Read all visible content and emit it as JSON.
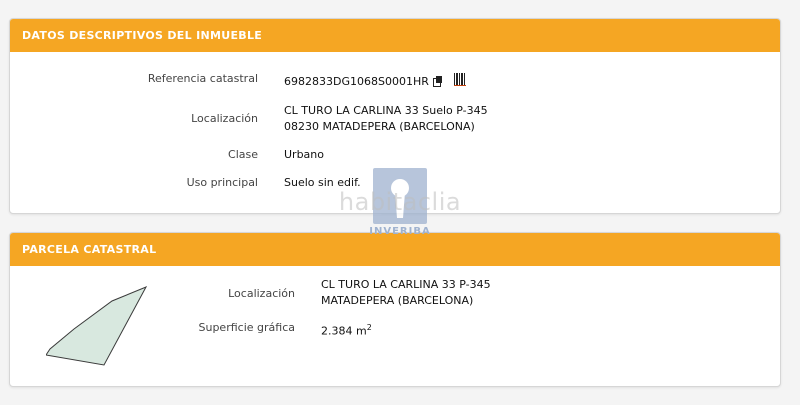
{
  "descriptive": {
    "title": "DATOS DESCRIPTIVOS DEL INMUEBLE",
    "rows": [
      {
        "label": "Referencia catastral",
        "value": "6982833DG1068S0001HR"
      },
      {
        "label": "Localización",
        "value_line1": "CL TURO LA CARLINA 33 Suelo P-345",
        "value_line2": "08230 MATADEPERA (BARCELONA)"
      },
      {
        "label": "Clase",
        "value": "Urbano"
      },
      {
        "label": "Uso principal",
        "value": "Suelo sin edif."
      }
    ],
    "icons": [
      "copy-icon",
      "barcode-icon"
    ]
  },
  "parcel": {
    "title": "PARCELA CATASTRAL",
    "rows": [
      {
        "label": "Localización",
        "value_line1": "CL TURO LA CARLINA 33 P-345",
        "value_line2": "MATADEPERA (BARCELONA)"
      },
      {
        "label": "Superficie gráfica",
        "value": "2.384 m",
        "unit_sup": "2"
      }
    ],
    "shape_fill": "#d8e8df"
  },
  "watermark": {
    "text": "habitaclia",
    "subtext": "INVERIBA"
  },
  "colors": {
    "header_bg": "#f5a623",
    "header_text": "#ffffff"
  }
}
